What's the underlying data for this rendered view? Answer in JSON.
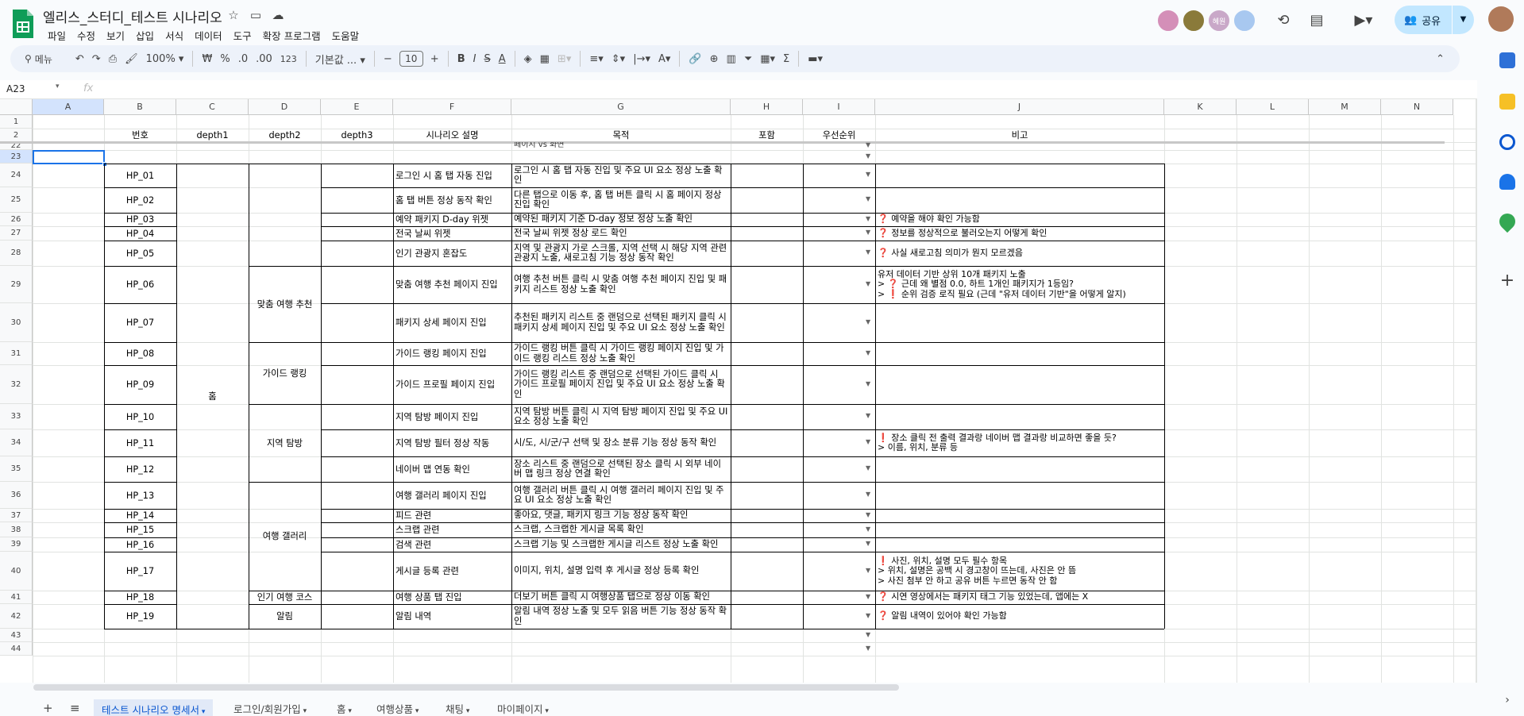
{
  "doc": {
    "title": "엘리스_스터디_테스트 시나리오"
  },
  "menu": [
    "파일",
    "수정",
    "보기",
    "삽입",
    "서식",
    "데이터",
    "도구",
    "확장 프로그램",
    "도움말"
  ],
  "toolbar": {
    "search": "메뉴",
    "zoom": "100%",
    "currency": "₩",
    "percent": "%",
    "dec_dec": ".0",
    "dec_inc": ".00",
    "num_format": "123",
    "font": "기본값 ...",
    "font_size": "10"
  },
  "avatars": [
    {
      "label": "",
      "color": "#d48fb8"
    },
    {
      "label": "",
      "color": "#8a7a3a"
    },
    {
      "label": "혜원",
      "color": "#c9a8c8"
    },
    {
      "label": "",
      "color": "#a8c8f0"
    }
  ],
  "share": {
    "label": "공유"
  },
  "namebox": "A23",
  "fx": "fx",
  "columns": [
    "A",
    "B",
    "C",
    "D",
    "E",
    "F",
    "G",
    "H",
    "I",
    "J",
    "K",
    "L",
    "M",
    "N"
  ],
  "header_row": {
    "b": "번호",
    "c": "depth1",
    "d": "depth2",
    "e": "depth3",
    "f": "시나리오 설명",
    "g": "목적",
    "h": "포함",
    "i": "우선순위",
    "j": "비고"
  },
  "row_numbers": [
    "1",
    "2",
    "22",
    "23",
    "24",
    "25",
    "26",
    "27",
    "28",
    "29",
    "30",
    "31",
    "32",
    "33",
    "34",
    "35",
    "36",
    "37",
    "38",
    "39",
    "40",
    "41",
    "42",
    "43",
    "44"
  ],
  "partial_text": "페이지 vs 화면",
  "depth1_home": "홈",
  "depth2": {
    "custom": "맞춤 여행 추천",
    "guide": "가이드 랭킹",
    "region": "지역 탐방",
    "gallery": "여행 갤러리",
    "popular": "인기 여행 코스",
    "alarm": "알림"
  },
  "rows": [
    {
      "id": "HP_01",
      "f": "로그인 시 홈 탭 자동 진입",
      "g": "로그인 시 홈 탭 자동 진입 및 주요 UI 요소 정상 노출 확인",
      "j": ""
    },
    {
      "id": "HP_02",
      "f": "홈 탭 버튼 정상 동작 확인",
      "g": "다른 탭으로 이동 후, 홈 탭 버튼 클릭 시 홈 페이지 정상 진입 확인",
      "j": ""
    },
    {
      "id": "HP_03",
      "f": "예약 패키지 D-day 위젯",
      "g": "예약된 패키지 기준 D-day 정보 정상 노출 확인",
      "j": "❓ 예약을 해야 확인 가능함"
    },
    {
      "id": "HP_04",
      "f": "전국 날씨 위젯",
      "g": "전국 날씨 위젯 정상 로드 확인",
      "j": "❓ 정보를 정상적으로 불러오는지 어떻게 확인"
    },
    {
      "id": "HP_05",
      "f": "인기 관광지 혼잡도",
      "g": "지역 및 관광지 가로 스크롤, 지역 선택 시 해당 지역 관련 관광지 노출, 새로고침 기능 정상 동작 확인",
      "j": "❓ 사실 새로고침 의미가 뭔지 모르겠음"
    },
    {
      "id": "HP_06",
      "f": "맞춤 여행 추천 페이지 진입",
      "g": "여행 추천 버튼 클릭 시 맞춤 여행 추천 페이지 진입 및 패키지 리스트 정상 노출 확인",
      "j": "유저 데이터 기반 상위 10개 패키지 노출\n > ❓ 근데 왜 별점 0.0, 하트 1개인 패키지가 1등임?\n > ❗ 순위 검증 로직 필요 (근데 \"유저 데이터 기반\"을 어떻게 알지)"
    },
    {
      "id": "HP_07",
      "f": "패키지 상세 페이지 진입",
      "g": "추천된 패키지 리스트 중 랜덤으로 선택된 패키지 클릭 시 패키지 상세 페이지 진입 및 주요 UI 요소 정상 노출 확인",
      "j": ""
    },
    {
      "id": "HP_08",
      "f": "가이드 랭킹 페이지 진입",
      "g": "가이드 랭킹 버튼 클릭 시 가이드 랭킹 페이지 진입 및 가이드 랭킹 리스트 정상 노출 확인",
      "j": ""
    },
    {
      "id": "HP_09",
      "f": "가이드 프로필 페이지 진입",
      "g": "가이드 랭킹 리스트 중 랜덤으로 선택된 가이드 클릭 시 가이드 프로필 페이지 진입 및 주요 UI 요소 정상 노출 확인",
      "j": ""
    },
    {
      "id": "HP_10",
      "f": "지역 탐방 페이지 진입",
      "g": "지역 탐방 버튼 클릭 시 지역 탐방 페이지 진입 및 주요 UI 요소 정상 노출 확인",
      "j": ""
    },
    {
      "id": "HP_11",
      "f": "지역 탐방 필터 정상 작동",
      "g": "시/도, 시/군/구 선택 및 장소 분류 기능 정상 동작 확인",
      "j": "❗ 장소 클릭 전 출력 결과랑 네이버 맵 결과랑 비교하면 좋을 듯?\n  > 이름, 위치, 분류 등"
    },
    {
      "id": "HP_12",
      "f": "네이버 맵 연동 확인",
      "g": "장소 리스트 중 랜덤으로 선택된 장소 클릭 시 외부 네이버 맵 링크 정상 연결 확인",
      "j": ""
    },
    {
      "id": "HP_13",
      "f": "여행 갤러리 페이지 진입",
      "g": "여행 갤러리 버튼 클릭 시 여행 갤러리 페이지 진입 및 주요 UI 요소 정상 노출 확인",
      "j": ""
    },
    {
      "id": "HP_14",
      "f": "피드 관련",
      "g": "좋아요, 댓글, 패키지 링크 기능 정상 동작 확인",
      "j": ""
    },
    {
      "id": "HP_15",
      "f": "스크랩 관련",
      "g": "스크랩, 스크랩한 게시글 목록 확인",
      "j": ""
    },
    {
      "id": "HP_16",
      "f": "검색 관련",
      "g": "스크랩 기능 및 스크랩한 게시글 리스트 정상 노출 확인",
      "j": ""
    },
    {
      "id": "HP_17",
      "f": "게시글 등록 관련",
      "g": "이미지, 위치, 설명 입력 후 게시글 정상 등록 확인",
      "j": "❗ 사진, 위치, 설명 모두 필수 항목\n > 위치, 설명은 공백 시 경고창이 뜨는데, 사진은 안 뜸\n > 사진 첨부 안 하고 공유 버튼 누르면 동작 안 함"
    },
    {
      "id": "HP_18",
      "f": "여행 상품 탭 진입",
      "g": "더보기 버튼 클릭 시 여행상품 탭으로 정상 이동 확인",
      "j": "❓ 시연 영상에서는 패키지 태그 기능 있었는데, 앱에는 X"
    },
    {
      "id": "HP_19",
      "f": "알림 내역",
      "g": "알림 내역 정상 노출 및 모두 읽음 버튼 기능 정상 동작 확인",
      "j": "❓ 알림 내역이 있어야 확인 가능함"
    }
  ],
  "sheet_tabs": [
    "테스트 시나리오 명세서",
    "로그인/회원가입",
    "홈",
    "여행상품",
    "채팅",
    "마이페이지"
  ]
}
